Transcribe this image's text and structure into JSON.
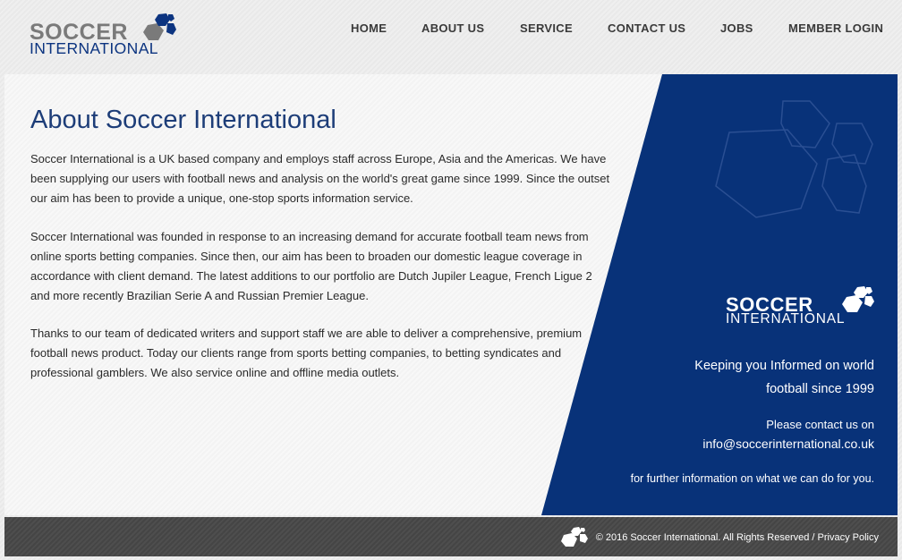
{
  "brand": {
    "word1": "SOCCER",
    "word2": "INTERNATIONAL",
    "colors": {
      "navy": "#0c3480",
      "grey": "#7a7a7a",
      "panel_blue": "#083279"
    }
  },
  "nav": {
    "items": [
      {
        "label": "HOME"
      },
      {
        "label": "ABOUT US"
      },
      {
        "label": "SERVICE"
      },
      {
        "label": "CONTACT US"
      },
      {
        "label": "JOBS"
      },
      {
        "label": "MEMBER LOGIN"
      }
    ]
  },
  "main": {
    "title": "About Soccer International",
    "paragraphs": [
      "Soccer International is a UK based company and employs staff across Europe, Asia and the Americas. We have been supplying our users with football news and analysis on the world's great game since 1999. Since the outset our aim has been to provide a unique, one-stop sports information service.",
      "Soccer International was founded in response to an increasing demand for accurate football team news from online sports betting companies. Since then, our aim has been to broaden our domestic league coverage in accordance with client demand. The latest additions to our portfolio are Dutch Jupiler League, French Ligue 2 and more recently Brazilian Serie A and Russian Premier League.",
      "Thanks to our team of dedicated writers and support staff we are able to deliver a comprehensive, premium football news product. Today our clients range from sports betting companies, to betting syndicates and professional gamblers. We also service online and offline media outlets."
    ]
  },
  "side": {
    "tagline_line1": "Keeping you Informed on world",
    "tagline_line2": "football since 1999",
    "contact_prompt": "Please contact us on",
    "contact_email": "info@soccerinternational.co.uk",
    "contact_note": "for further information on what we can do for you."
  },
  "footer": {
    "copyright": "© 2016 Soccer International. All Rights Reserved /",
    "privacy_label": "Privacy Policy"
  }
}
